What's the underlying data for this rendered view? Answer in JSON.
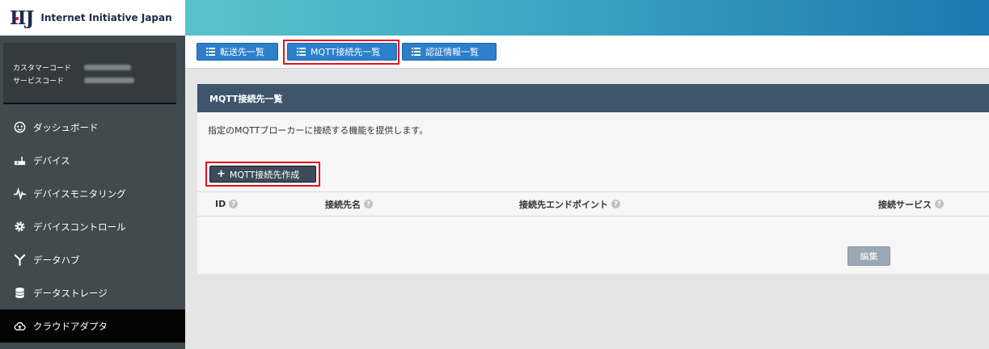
{
  "logo": {
    "mark": "IIJ",
    "text": "Internet Initiative Japan"
  },
  "account": {
    "customer_code_label": "カスタマーコード",
    "service_code_label": "サービスコード"
  },
  "sidebar": {
    "items": [
      {
        "label": "ダッシュボード",
        "icon": "dashboard-icon"
      },
      {
        "label": "デバイス",
        "icon": "device-icon"
      },
      {
        "label": "デバイスモニタリング",
        "icon": "pulse-icon"
      },
      {
        "label": "デバイスコントロール",
        "icon": "gear-icon"
      },
      {
        "label": "データハブ",
        "icon": "hub-icon"
      },
      {
        "label": "データストレージ",
        "icon": "database-icon"
      },
      {
        "label": "クラウドアダプタ",
        "icon": "cloud-upload-icon",
        "active": true
      }
    ]
  },
  "tabs": [
    {
      "label": "転送先一覧",
      "icon": "list-icon"
    },
    {
      "label": "MQTT接続先一覧",
      "icon": "list-icon",
      "highlighted": true
    },
    {
      "label": "認証情報一覧",
      "icon": "list-icon"
    }
  ],
  "panel": {
    "title": "MQTT接続先一覧",
    "description": "指定のMQTTブローカーに接続する機能を提供します。",
    "create_button": "MQTT接続先作成",
    "columns": [
      {
        "label": "ID"
      },
      {
        "label": "接続先名"
      },
      {
        "label": "接続先エンドポイント"
      },
      {
        "label": "接続サービス"
      }
    ],
    "edit_button": "編集"
  },
  "colors": {
    "accent_blue": "#2d7fcb",
    "panel_header": "#3e556b",
    "highlight_red": "#e3141f",
    "sidebar_bg": "#414a4f"
  }
}
